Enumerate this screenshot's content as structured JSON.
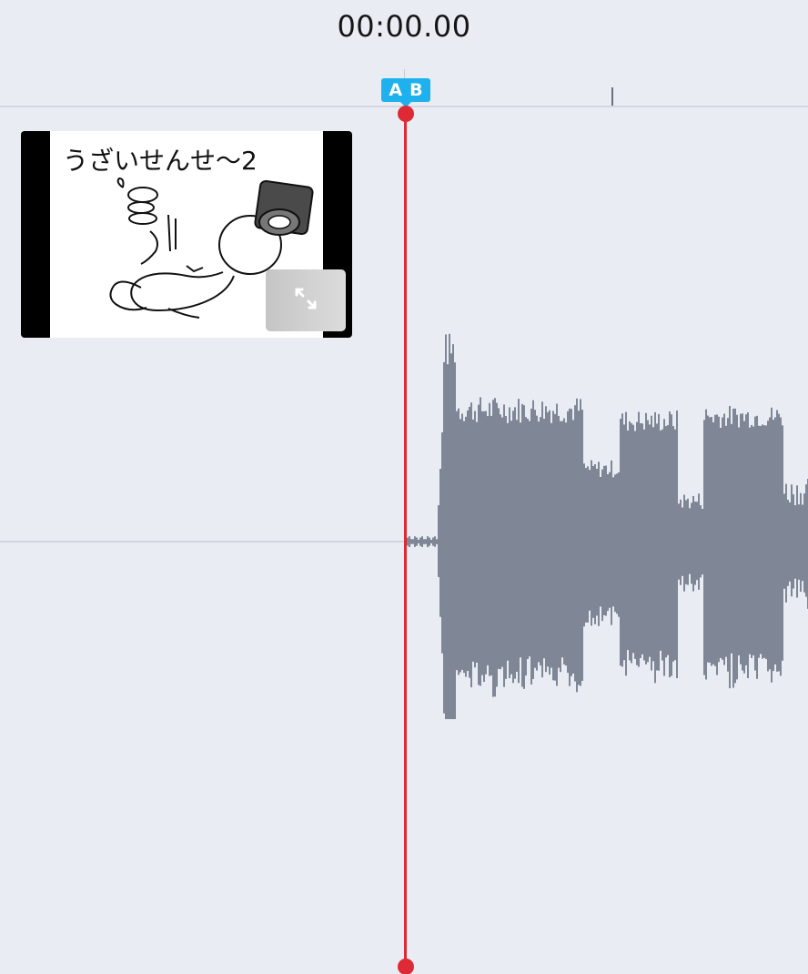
{
  "header": {
    "timecode": "00:00.00"
  },
  "loop_marker": {
    "a_label": "A",
    "b_label": "B"
  },
  "clip": {
    "thumbnail_text": "うざいせんせ〜2",
    "expand_icon": "expand-arrows-icon"
  },
  "colors": {
    "background": "#e9edf3",
    "marker_blue": "#1fb0ee",
    "playhead_red": "#dd2a35",
    "waveform": "#7f8797"
  }
}
